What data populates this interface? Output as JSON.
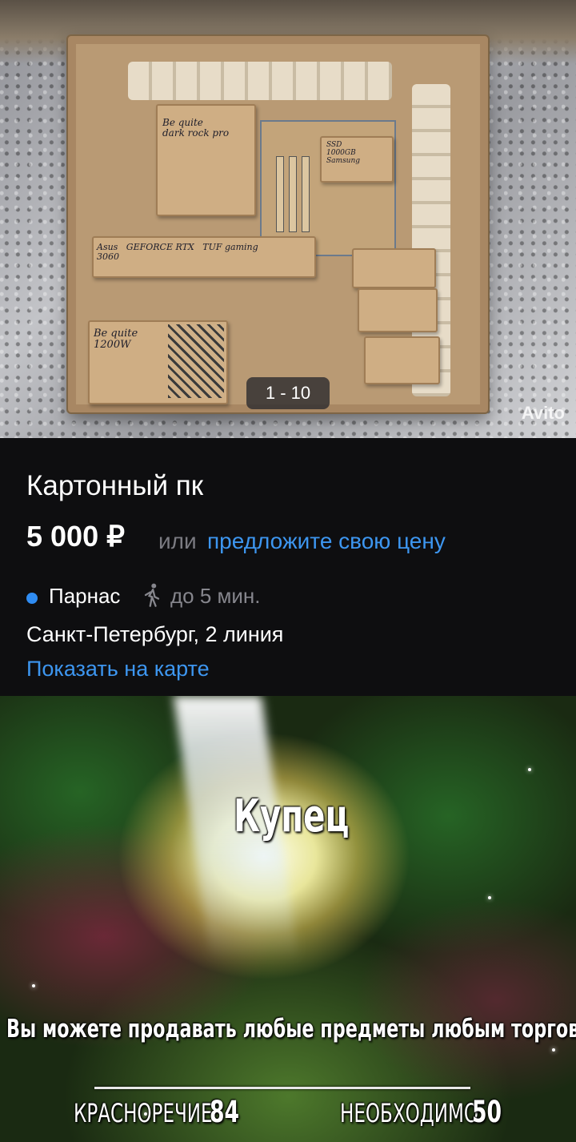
{
  "photo": {
    "counter": "1 - 10",
    "watermark": "Avito",
    "labels": {
      "cooler": "Be quite\ndark rock pro",
      "ssd": "SSD\n1000GB\nSamsung",
      "gpu": "Asus   GEFORCE RTX   TUF gaming\n3060",
      "psu": "Be quite\n1200W"
    }
  },
  "listing": {
    "title": "Картонный пк",
    "price": "5 000 ₽",
    "or_text": "или",
    "offer_link": "предложите свою цену",
    "metro_station": "Парнас",
    "walk_time": "до 5 мин.",
    "address": "Санкт-Петербург, 2 линия",
    "map_link": "Показать на карте",
    "colors": {
      "accent": "#3d96f0",
      "metro_dot": "#2f8cf2",
      "muted": "#7b7b82",
      "background": "#0e0e10"
    }
  },
  "meme": {
    "perk_name": "Купец",
    "perk_description": "Вы можете продавать любые предметы любым торговцам.",
    "skill_label": "КРАСНОРЕЧИЕ",
    "skill_value": "84",
    "required_label": "НЕОБХОДИМО",
    "required_value": "50"
  }
}
